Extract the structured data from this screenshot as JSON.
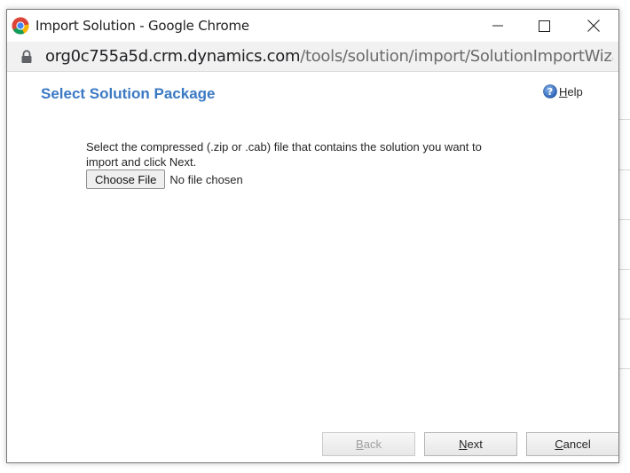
{
  "window": {
    "title": "Import Solution - Google Chrome",
    "url_host": "org0c755a5d.crm.dynamics.com",
    "url_path": "/tools/solution/import/SolutionImportWizard.a…"
  },
  "icons": {
    "app": "chrome-logo-icon",
    "secure": "lock-icon",
    "help": "help-icon",
    "minimize": "minimize-icon",
    "maximize": "maximize-icon",
    "close": "close-icon"
  },
  "page": {
    "title": "Select Solution Package",
    "help_label": "Help",
    "instructions": "Select the compressed (.zip or .cab) file that contains the solution you want to import and click Next.",
    "choose_file_label": "Choose File",
    "file_status": "No file chosen"
  },
  "footer": {
    "back_label": "Back",
    "next_label": "Next",
    "cancel_label": "Cancel"
  },
  "colors": {
    "title_blue": "#3b79c4",
    "help_icon_blue": "#2f6fc6",
    "disabled_text": "#a0a0a0"
  }
}
